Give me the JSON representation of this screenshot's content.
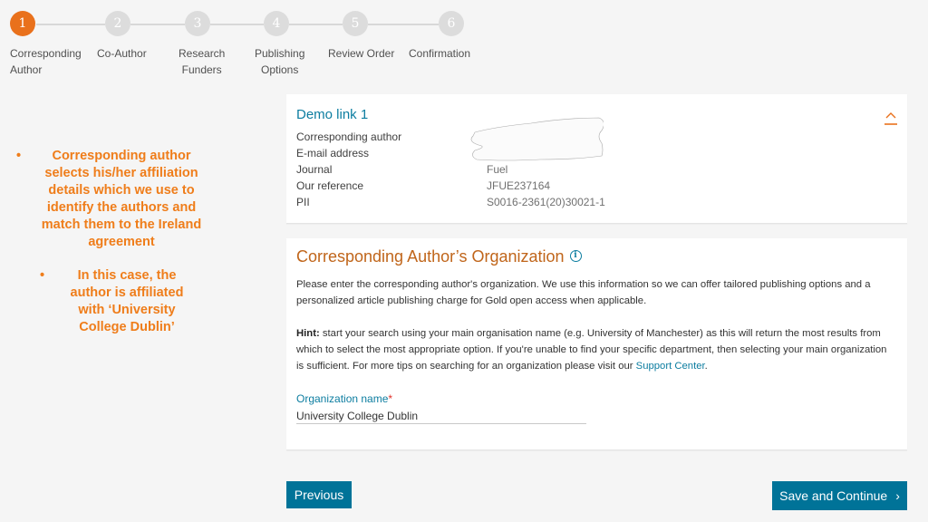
{
  "stepper": {
    "steps": [
      {
        "number": "1",
        "label_line1": "Corresponding",
        "label_line2": "Author",
        "state": "active"
      },
      {
        "number": "2",
        "label_line1": "Co-Author",
        "label_line2": "",
        "state": "inactive"
      },
      {
        "number": "3",
        "label_line1": "Research",
        "label_line2": "Funders",
        "state": "inactive"
      },
      {
        "number": "4",
        "label_line1": "Publishing",
        "label_line2": "Options",
        "state": "inactive"
      },
      {
        "number": "5",
        "label_line1": "Review Order",
        "label_line2": "",
        "state": "inactive"
      },
      {
        "number": "6",
        "label_line1": "Confirmation",
        "label_line2": "",
        "state": "inactive"
      }
    ],
    "active_color": "#e9711c",
    "inactive_color": "#dcdcdc"
  },
  "annotation": {
    "bullets": [
      "Corresponding author selects his/her affiliation details which we use to identify the authors and match them to the Ireland agreement",
      "In this case, the author is affiliated with ‘University College Dublin’"
    ],
    "bullet_glyph": "•",
    "color": "#ef7d1a"
  },
  "summary_card": {
    "title": "Demo link 1",
    "rows": [
      {
        "label": "Corresponding author",
        "value": ""
      },
      {
        "label": "E-mail address",
        "value": ""
      },
      {
        "label": "Journal",
        "value": "Fuel"
      },
      {
        "label": "Our reference",
        "value": "JFUE237164"
      },
      {
        "label": "PII",
        "value": "S0016-2361(20)30021-1"
      }
    ],
    "collapse_icon": "chevron-up-icon"
  },
  "org_card": {
    "title": "Corresponding Author’s Organization",
    "info_icon": "i",
    "intro": "Please enter the corresponding author's organization. We use this information so we can offer tailored publishing options and a personalized article publishing charge for Gold open access when applicable.",
    "hint_label": "Hint:",
    "hint_text": " start your search using your main organisation name (e.g. University of Manchester) as this will return the most results from which to select the most appropriate option. If you're unable to find your specific department, then selecting your main organization is sufficient. For more tips on searching for an organization please visit our ",
    "hint_link": "Support Center",
    "hint_end": ".",
    "field_label": "Organization name",
    "required_mark": "*",
    "field_value": "University College Dublin"
  },
  "actions": {
    "previous_label": "Previous",
    "save_label": "Save and Continue",
    "save_chevron": "›",
    "button_color": "#007398"
  }
}
